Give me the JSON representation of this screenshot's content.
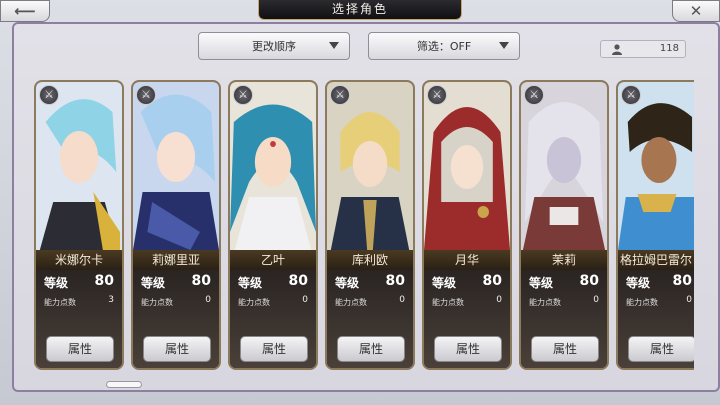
{
  "screen": {
    "title": "选择角色"
  },
  "controls": {
    "sort_label": "更改顺序",
    "filter_label": "筛选：OFF",
    "owned_count": "118"
  },
  "labels": {
    "level": "等级",
    "ability_points": "能力点数",
    "attribute_button": "属性"
  },
  "cards": [
    {
      "name": "米娜尔卡",
      "level": "80",
      "ability_points": "3"
    },
    {
      "name": "莉娜里亚",
      "level": "80",
      "ability_points": "0"
    },
    {
      "name": "乙叶",
      "level": "80",
      "ability_points": "0"
    },
    {
      "name": "库利欧",
      "level": "80",
      "ability_points": "0"
    },
    {
      "name": "月华",
      "level": "80",
      "ability_points": "0"
    },
    {
      "name": "茉莉",
      "level": "80",
      "ability_points": "0"
    },
    {
      "name": "格拉姆巴雷尔",
      "level": "80",
      "ability_points": "0"
    }
  ],
  "colors": {
    "accent_gold": "#c9a66b",
    "card_border": "#8c7a5c"
  }
}
